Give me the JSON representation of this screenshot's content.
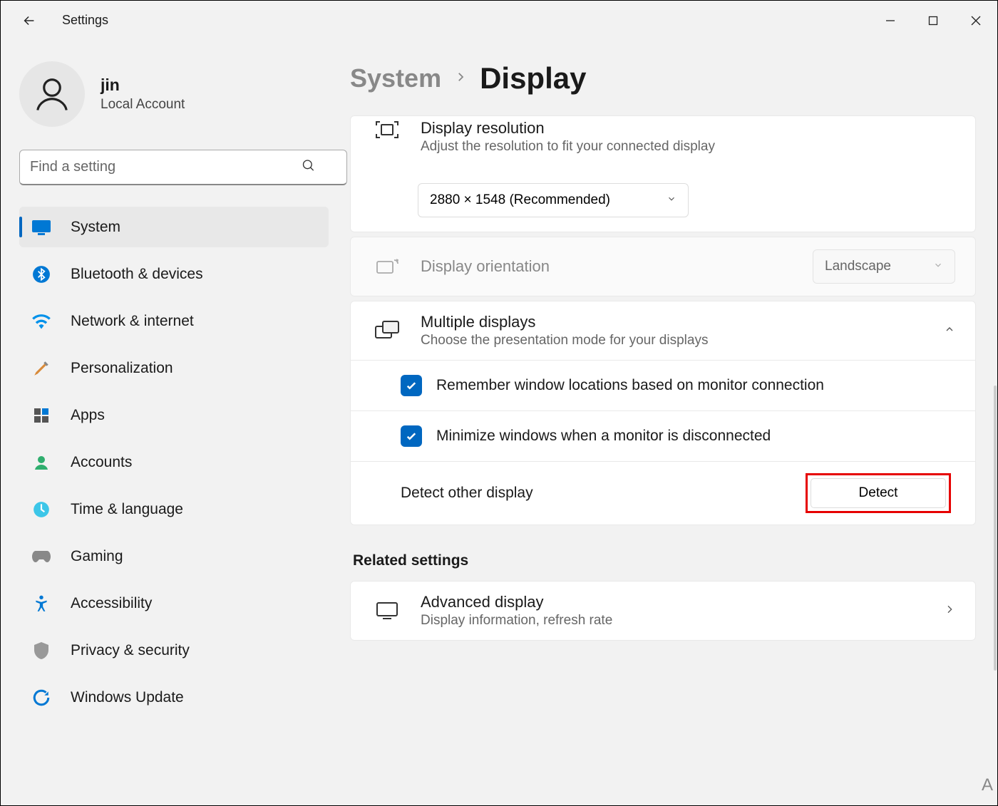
{
  "app": {
    "title": "Settings"
  },
  "user": {
    "name": "jin",
    "account_type": "Local Account"
  },
  "search": {
    "placeholder": "Find a setting"
  },
  "nav": {
    "items": [
      {
        "label": "System"
      },
      {
        "label": "Bluetooth & devices"
      },
      {
        "label": "Network & internet"
      },
      {
        "label": "Personalization"
      },
      {
        "label": "Apps"
      },
      {
        "label": "Accounts"
      },
      {
        "label": "Time & language"
      },
      {
        "label": "Gaming"
      },
      {
        "label": "Accessibility"
      },
      {
        "label": "Privacy & security"
      },
      {
        "label": "Windows Update"
      }
    ]
  },
  "breadcrumb": {
    "parent": "System",
    "current": "Display"
  },
  "resolution": {
    "title": "Display resolution",
    "subtitle": "Adjust the resolution to fit your connected display",
    "value": "2880 × 1548 (Recommended)"
  },
  "orientation": {
    "title": "Display orientation",
    "value": "Landscape"
  },
  "multiple": {
    "title": "Multiple displays",
    "subtitle": "Choose the presentation mode for your displays",
    "opt1": "Remember window locations based on monitor connection",
    "opt2": "Minimize windows when a monitor is disconnected",
    "detect_label": "Detect other display",
    "detect_btn": "Detect"
  },
  "related": {
    "heading": "Related settings",
    "advanced_title": "Advanced display",
    "advanced_sub": "Display information, refresh rate"
  }
}
